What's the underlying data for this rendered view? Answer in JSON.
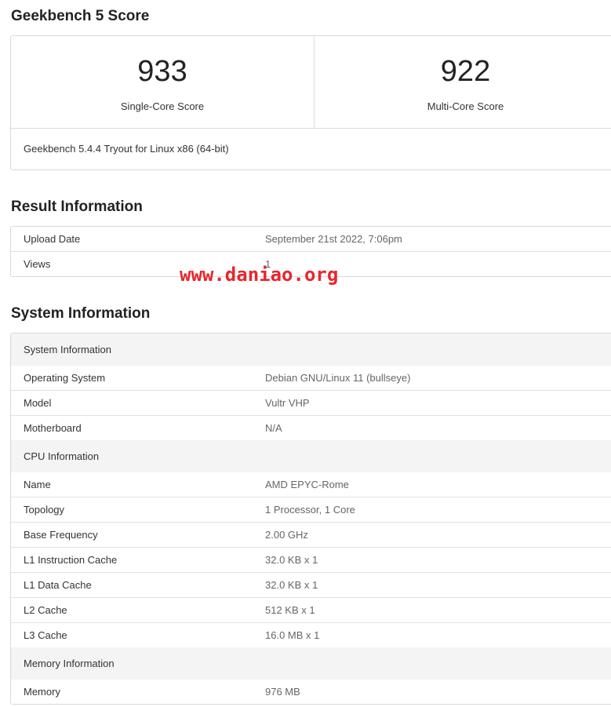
{
  "geekbench": {
    "title": "Geekbench 5 Score",
    "single_core": {
      "value": "933",
      "label": "Single-Core Score"
    },
    "multi_core": {
      "value": "922",
      "label": "Multi-Core Score"
    },
    "version": "Geekbench 5.4.4 Tryout for Linux x86 (64-bit)"
  },
  "result_info": {
    "title": "Result Information",
    "rows": [
      {
        "label": "Upload Date",
        "value": "September 21st 2022, 7:06pm"
      },
      {
        "label": "Views",
        "value": "1"
      }
    ]
  },
  "watermark": "www.daniao.org",
  "system_info": {
    "title": "System Information",
    "sections": [
      {
        "header": "System Information",
        "rows": [
          {
            "label": "Operating System",
            "value": "Debian GNU/Linux 11 (bullseye)"
          },
          {
            "label": "Model",
            "value": "Vultr VHP"
          },
          {
            "label": "Motherboard",
            "value": "N/A"
          }
        ]
      },
      {
        "header": "CPU Information",
        "rows": [
          {
            "label": "Name",
            "value": "AMD EPYC-Rome"
          },
          {
            "label": "Topology",
            "value": "1 Processor, 1 Core"
          },
          {
            "label": "Base Frequency",
            "value": "2.00 GHz"
          },
          {
            "label": "L1 Instruction Cache",
            "value": "32.0 KB x 1"
          },
          {
            "label": "L1 Data Cache",
            "value": "32.0 KB x 1"
          },
          {
            "label": "L2 Cache",
            "value": "512 KB x 1"
          },
          {
            "label": "L3 Cache",
            "value": "16.0 MB x 1"
          }
        ]
      },
      {
        "header": "Memory Information",
        "rows": [
          {
            "label": "Memory",
            "value": "976 MB"
          }
        ]
      }
    ]
  }
}
